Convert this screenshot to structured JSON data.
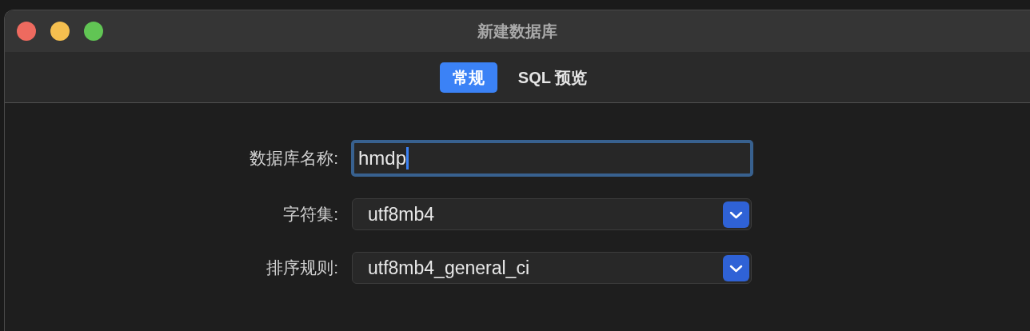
{
  "window": {
    "title": "新建数据库"
  },
  "tabs": [
    {
      "label": "常规",
      "selected": true
    },
    {
      "label": "SQL 预览",
      "selected": false
    }
  ],
  "fields": [
    {
      "kind": "text",
      "label": "数据库名称:",
      "value": "hmdp"
    },
    {
      "kind": "select",
      "label": "字符集:",
      "value": "utf8mb4"
    },
    {
      "kind": "select",
      "label": "排序规则:",
      "value": "utf8mb4_general_ci"
    }
  ]
}
